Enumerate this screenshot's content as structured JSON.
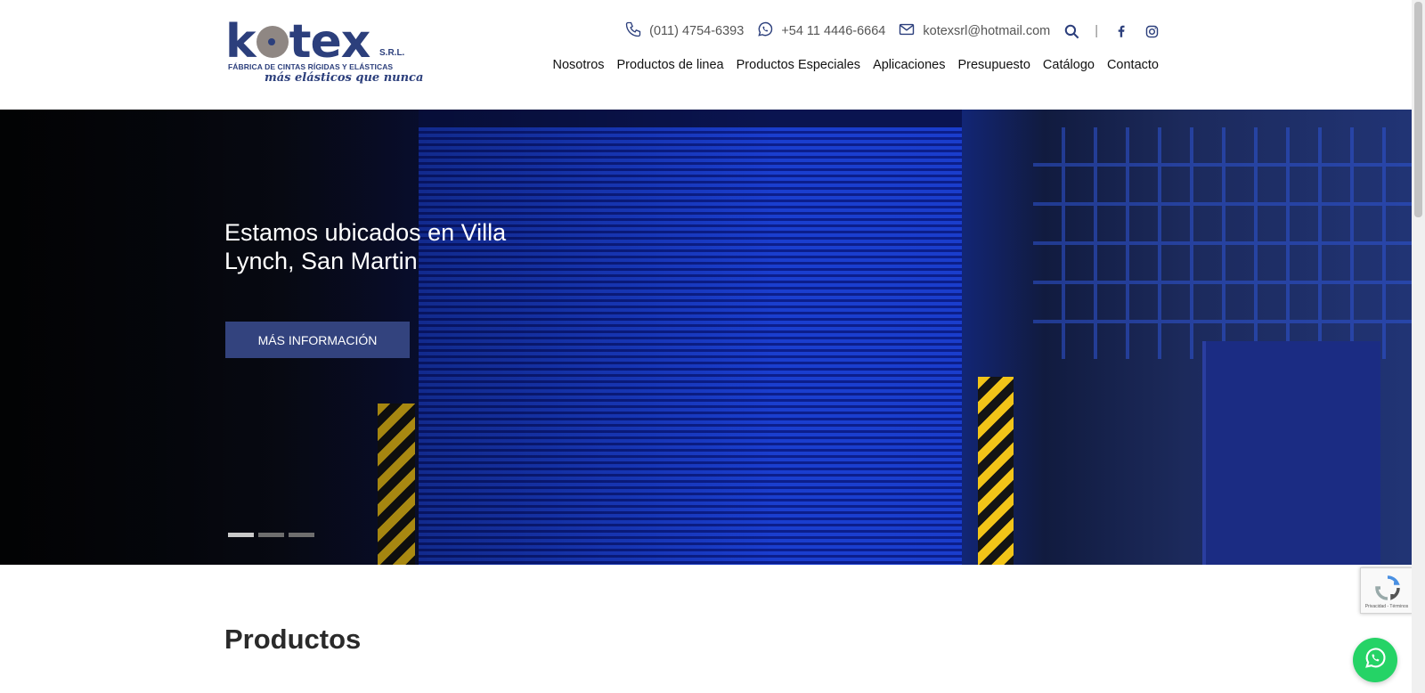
{
  "brand": {
    "logo_word": "kotex",
    "logo_srl": "S.R.L.",
    "logo_subtitle": "FÁBRICA DE CINTAS RÍGIDAS Y ELÁSTICAS",
    "logo_tagline": "más elásticos que nunca",
    "primary_color": "#2c3f7c"
  },
  "contact": {
    "phone": "(011) 4754-6393",
    "whatsapp": "+54 11 4446-6664",
    "email": "kotexsrl@hotmail.com",
    "separator": "|",
    "icons": [
      "phone-icon",
      "whatsapp-icon",
      "envelope-icon",
      "search-icon",
      "facebook-icon",
      "instagram-icon"
    ]
  },
  "nav": {
    "items": [
      {
        "label": "Nosotros"
      },
      {
        "label": "Productos de linea"
      },
      {
        "label": "Productos Especiales"
      },
      {
        "label": "Aplicaciones"
      },
      {
        "label": "Presupuesto"
      },
      {
        "label": "Catálogo"
      },
      {
        "label": "Contacto"
      }
    ]
  },
  "hero": {
    "title": "Estamos ubicados en Villa Lynch, San Martin",
    "button_label": "MÁS INFORMACIÓN",
    "button_color": "#33437e",
    "slides_total": 3,
    "active_slide": 1
  },
  "section": {
    "title": "Productos"
  },
  "recaptcha": {
    "footer": "Privacidad - Términos"
  },
  "whatsapp_float": {
    "color": "#25d366"
  }
}
